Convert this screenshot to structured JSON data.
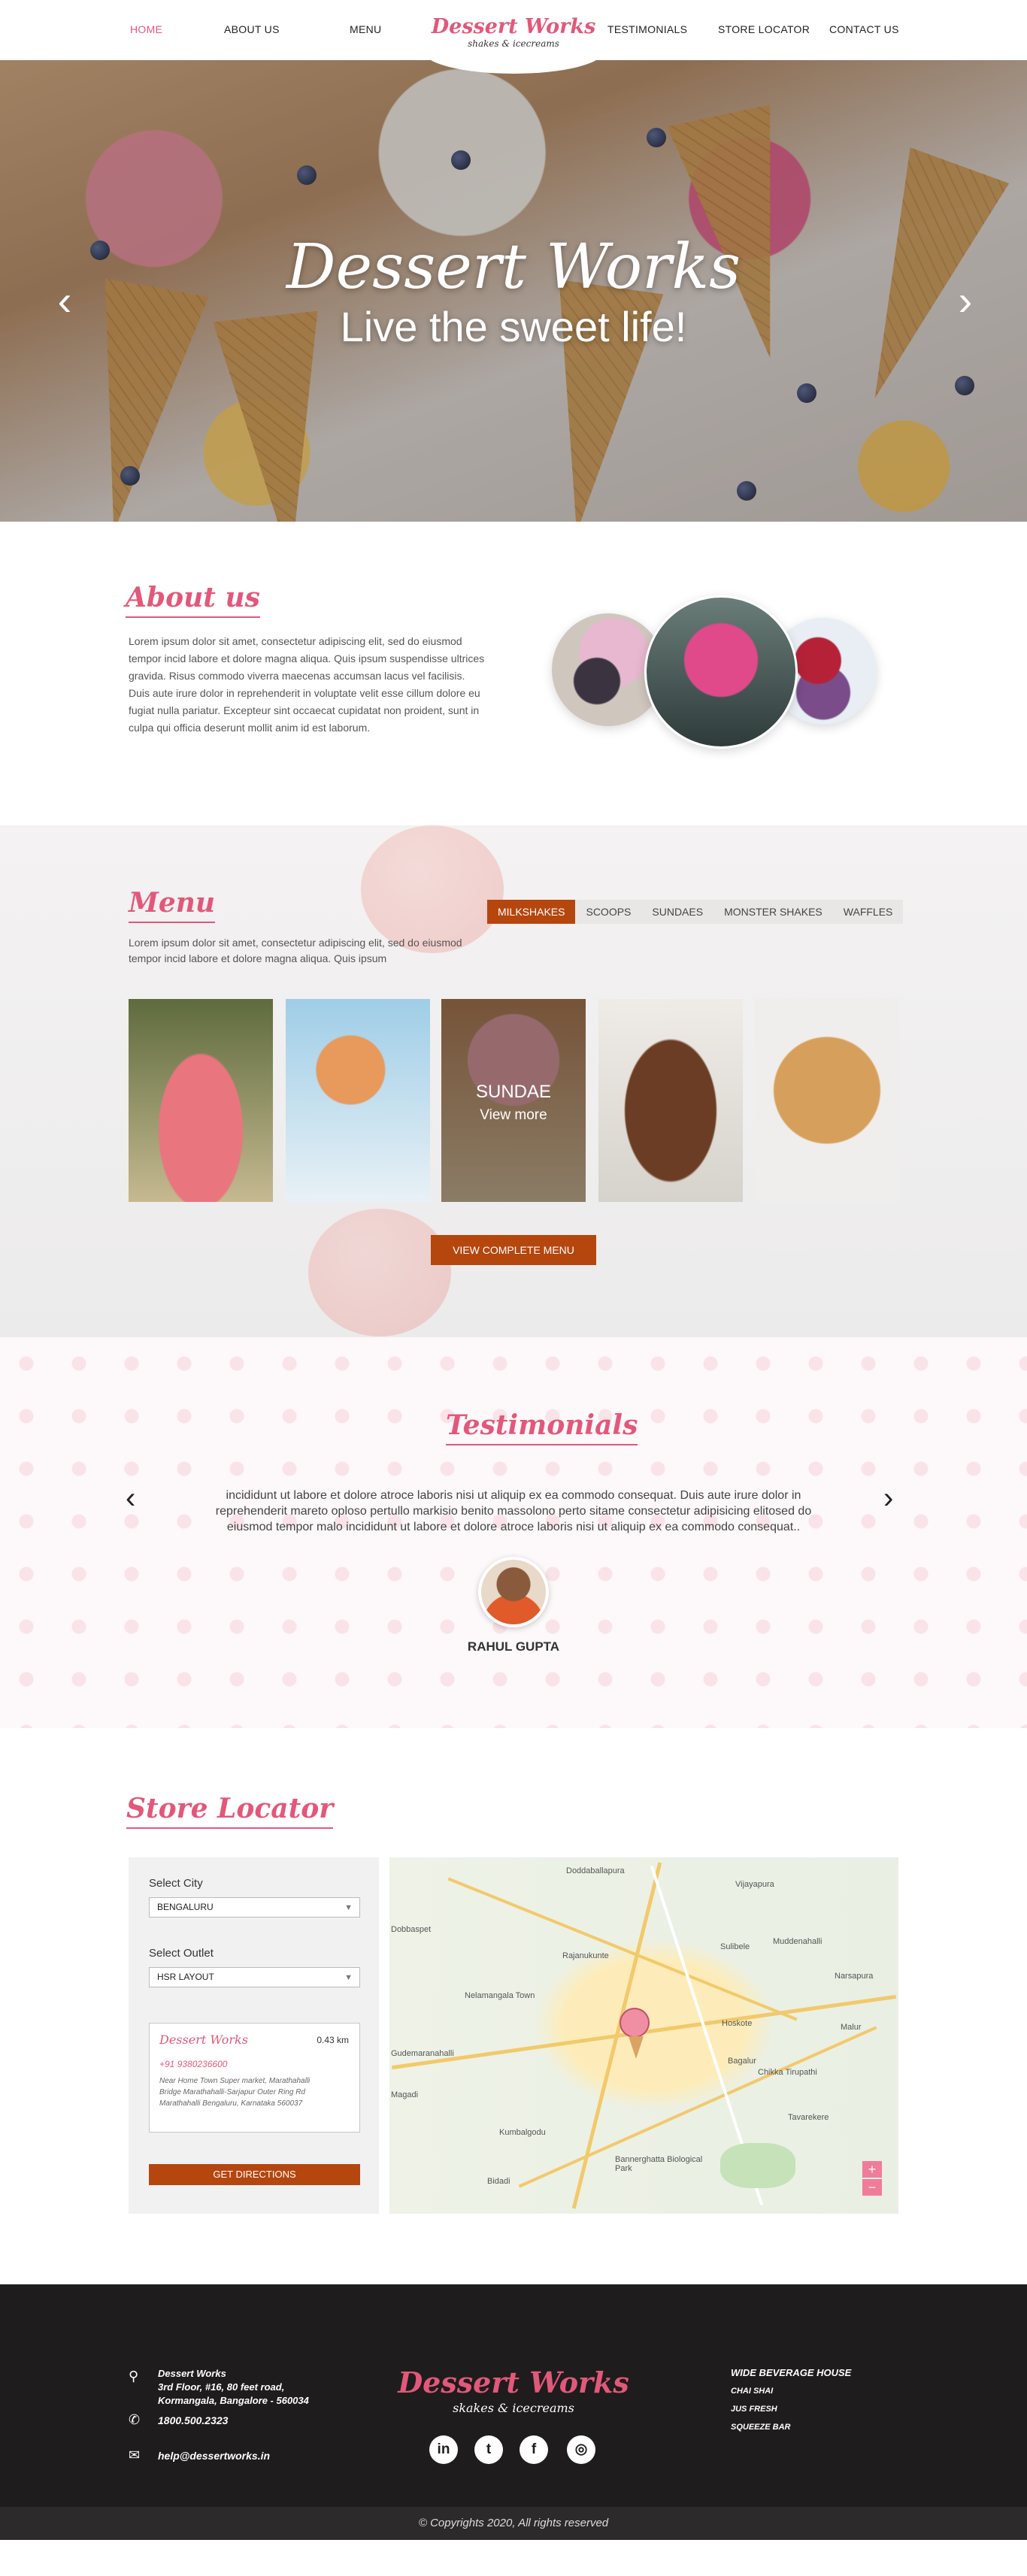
{
  "nav": {
    "items": [
      "HOME",
      "ABOUT US",
      "MENU",
      "TESTIMONIALS",
      "STORE LOCATOR",
      "CONTACT US"
    ],
    "logo_main": "Dessert Works",
    "logo_sub": "shakes & icecreams"
  },
  "hero": {
    "title": "Dessert Works",
    "subtitle": "Live the sweet life!",
    "prev": "‹",
    "next": "›"
  },
  "about": {
    "title": "About us",
    "text": "Lorem ipsum dolor sit amet, consectetur adipiscing elit, sed do eiusmod tempor incid labore et dolore magna aliqua. Quis ipsum suspendisse ultrices gravida. Risus commodo viverra maecenas accumsan lacus vel facilisis. Duis aute irure dolor in reprehenderit in voluptate velit esse cillum dolore eu fugiat nulla pariatur. Excepteur sint occaecat cupidatat non proident, sunt in culpa qui officia deserunt mollit anim id est laborum."
  },
  "menu": {
    "title": "Menu",
    "text": "Lorem ipsum dolor sit amet, consectetur adipiscing elit, sed do eiusmod tempor incid labore et dolore magna aliqua. Quis ipsum",
    "tabs": [
      "MILKSHAKES",
      "SCOOPS",
      "SUNDAES",
      "MONSTER SHAKES",
      "WAFFLES"
    ],
    "overlay_title": "SUNDAE",
    "overlay_more": "View more",
    "button": "VIEW COMPLETE MENU"
  },
  "testimonials": {
    "title": "Testimonials",
    "text": "incididunt ut labore et dolore atroce laboris nisi ut aliquip ex ea commodo consequat. Duis aute irure dolor in reprehenderit mareto oploso pertullo markisio benito massolono perto  sitame consectetur adipisicing elitosed do eiusmod tempor malo incididunt ut labore et dolore atroce laboris nisi ut aliquip ex ea commodo consequat..",
    "name": "RAHUL GUPTA",
    "prev": "‹",
    "next": "›"
  },
  "store": {
    "title": "Store Locator",
    "city_label": "Select City",
    "city_value": "BENGALURU",
    "outlet_label": "Select Outlet",
    "outlet_value": "HSR LAYOUT",
    "outlet": {
      "name": "Dessert Works",
      "distance": "0.43 km",
      "phone": "+91 9380236600",
      "address": "Near Home Town Super market, Marathahalli Bridge Marathahalli-Sarjapur Outer Ring Rd Marathahalli Bengaluru, Karnataka 560037"
    },
    "button": "GET DIRECTIONS",
    "map_labels": [
      "Doddaballapura",
      "Nelamangala Town",
      "Rajanukunte",
      "Vijayapura",
      "Sulibele",
      "Hoskote",
      "Muddenahalli",
      "Narsapura",
      "Kumbalgodu",
      "Bannerghatta Biological Park",
      "Bidadi",
      "Magadi",
      "Dobbaspet",
      "Gudemaranahalli",
      "Chikka Tirupathi",
      "Tavarekere",
      "Malur",
      "Bagalur"
    ],
    "zoom_in": "+",
    "zoom_out": "−"
  },
  "footer": {
    "company": "Dessert Works",
    "address_1": "3rd Floor, #16, 80 feet road,",
    "address_2": "Kormangala, Bangalore - 560034",
    "phone": "1800.500.2323",
    "email": "help@dessertworks.in",
    "logo_main": "Dessert Works",
    "logo_sub": "skakes & icecreams",
    "social": [
      "in",
      "t",
      "f",
      "◎"
    ],
    "beverages_title": "WIDE BEVERAGE HOUSE",
    "beverages": [
      "CHAI SHAI",
      "JUS FRESH",
      "SQUEEZE BAR"
    ],
    "copyright": "© Copyrights 2020, All rights reserved"
  },
  "colors": {
    "accent": "#e2587a",
    "button": "#b5460e",
    "footer": "#1e1c1c"
  }
}
